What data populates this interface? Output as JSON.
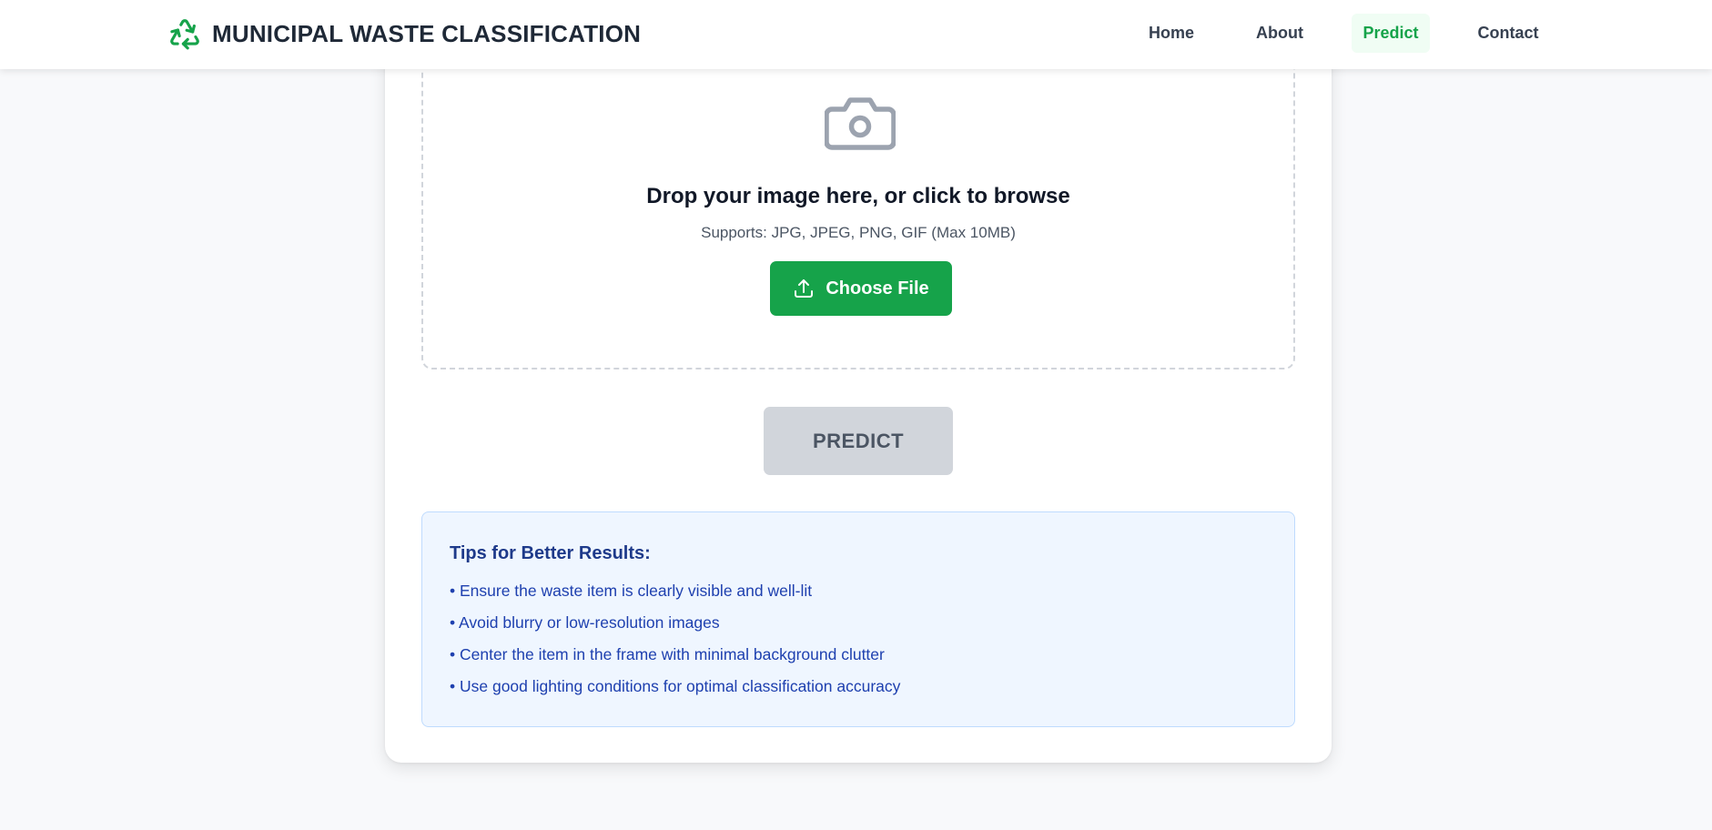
{
  "header": {
    "brand": "MUNICIPAL WASTE CLASSIFICATION",
    "logo_icon": "recycle-icon",
    "nav": [
      {
        "label": "Home",
        "active": false
      },
      {
        "label": "About",
        "active": false
      },
      {
        "label": "Predict",
        "active": true
      },
      {
        "label": "Contact",
        "active": false
      }
    ]
  },
  "upload": {
    "icon": "camera-icon",
    "title": "Drop your image here, or click to browse",
    "subtitle": "Supports: JPG, JPEG, PNG, GIF (Max 10MB)",
    "button_label": "Choose File",
    "button_icon": "upload-icon"
  },
  "predict": {
    "button_label": "PREDICT",
    "disabled": true
  },
  "tips": {
    "title": "Tips for Better Results:",
    "items": [
      "• Ensure the waste item is clearly visible and well-lit",
      "• Avoid blurry or low-resolution images",
      "• Center the item in the frame with minimal background clutter",
      "• Use good lighting conditions for optimal classification accuracy"
    ]
  },
  "colors": {
    "accent": "#16a34a",
    "page_background": "#f8f9fb",
    "tips_background": "#eff6ff",
    "tips_text": "#1e40af",
    "disabled_button": "#d1d5db"
  }
}
